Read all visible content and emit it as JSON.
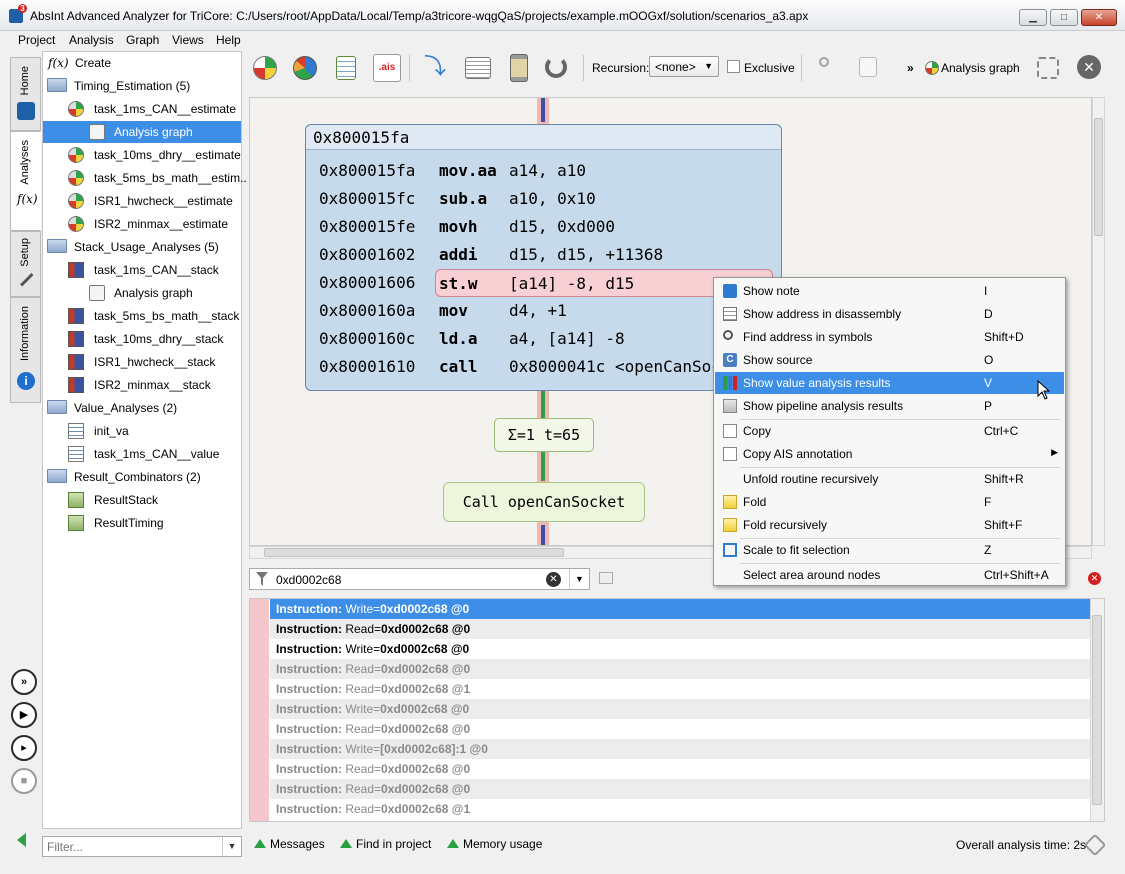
{
  "window": {
    "title": "AbsInt Advanced Analyzer for TriCore: C:/Users/root/AppData/Local/Temp/a3tricore-wqgQaS/projects/example.mOOGxf/solution/scenarios_a3.apx",
    "minimize": "▁",
    "maximize": "□",
    "close": "✕"
  },
  "menu": [
    "Project",
    "Analysis",
    "Graph",
    "Views",
    "Help"
  ],
  "vtabs": [
    "Home",
    "Analyses",
    "Setup",
    "Information"
  ],
  "tree": {
    "create_label": "Create",
    "fx_label": "f(x)",
    "items": [
      {
        "label": "Timing_Estimation (5)",
        "icon": "folder-icon",
        "indent": 0
      },
      {
        "label": "task_1ms_CAN__estimate",
        "icon": "gauge-icon",
        "indent": 1
      },
      {
        "label": "Analysis graph",
        "icon": "graph-icon",
        "indent": 2,
        "selected": true
      },
      {
        "label": "task_10ms_dhry__estimate",
        "icon": "gauge-icon",
        "indent": 1
      },
      {
        "label": "task_5ms_bs_math__estim..",
        "icon": "gauge-icon",
        "indent": 1
      },
      {
        "label": "ISR1_hwcheck__estimate",
        "icon": "gauge-icon",
        "indent": 1
      },
      {
        "label": "ISR2_minmax__estimate",
        "icon": "gauge-icon",
        "indent": 1
      },
      {
        "label": "Stack_Usage_Analyses (5)",
        "icon": "folder-icon",
        "indent": 0
      },
      {
        "label": "task_1ms_CAN__stack",
        "icon": "stack-icon",
        "indent": 1
      },
      {
        "label": "Analysis graph",
        "icon": "graph-icon",
        "indent": 2
      },
      {
        "label": "task_5ms_bs_math__stack",
        "icon": "stack-icon",
        "indent": 1
      },
      {
        "label": "task_10ms_dhry__stack",
        "icon": "stack-icon",
        "indent": 1
      },
      {
        "label": "ISR1_hwcheck__stack",
        "icon": "stack-icon",
        "indent": 1
      },
      {
        "label": "ISR2_minmax__stack",
        "icon": "stack-icon",
        "indent": 1
      },
      {
        "label": "Value_Analyses (2)",
        "icon": "folder-icon",
        "indent": 0
      },
      {
        "label": "init_va",
        "icon": "binary-icon",
        "indent": 1
      },
      {
        "label": "task_1ms_CAN__value",
        "icon": "binary-icon",
        "indent": 1
      },
      {
        "label": "Result_Combinators (2)",
        "icon": "folder-icon",
        "indent": 0
      },
      {
        "label": "ResultStack",
        "icon": "combinator-icon",
        "indent": 1
      },
      {
        "label": "ResultTiming",
        "icon": "combinator-icon",
        "indent": 1
      }
    ]
  },
  "filter": {
    "placeholder": "Filter..."
  },
  "toolbar": {
    "ais_label": ".ais",
    "recursion_label": "Recursion:",
    "recursion_value": "<none>",
    "exclusive_label": "Exclusive",
    "more": "»",
    "analysis_graph_label": "Analysis graph"
  },
  "graph": {
    "block_header": "0x800015fa",
    "instructions": [
      {
        "addr": "0x800015fa",
        "mnemonic": "mov.aa",
        "operands": "a14, a10"
      },
      {
        "addr": "0x800015fc",
        "mnemonic": "sub.a",
        "operands": "a10, 0x10"
      },
      {
        "addr": "0x800015fe",
        "mnemonic": "movh",
        "operands": "d15, 0xd000"
      },
      {
        "addr": "0x80001602",
        "mnemonic": "addi",
        "operands": "d15, d15, +11368"
      },
      {
        "addr": "0x80001606",
        "mnemonic": "st.w",
        "operands": "[a14] -8, d15",
        "highlighted": true
      },
      {
        "addr": "0x8000160a",
        "mnemonic": "mov",
        "operands": "d4, +1"
      },
      {
        "addr": "0x8000160c",
        "mnemonic": "ld.a",
        "operands": "a4, [a14] -8"
      },
      {
        "addr": "0x80001610",
        "mnemonic": "call",
        "operands": "0x8000041c <openCanSoc"
      }
    ],
    "edge_label": "Σ=1 t=65",
    "call_node": "Call openCanSocket"
  },
  "search": {
    "value": "0xd0002c68"
  },
  "results": [
    {
      "prefix": "Instruction:",
      "kind": " Write=",
      "value": "0xd0002c68 @0",
      "state": "selected"
    },
    {
      "prefix": "Instruction:",
      "kind": " Read=",
      "value": "0xd0002c68 @0",
      "state": "bold"
    },
    {
      "prefix": "Instruction:",
      "kind": " Write=",
      "value": "0xd0002c68 @0",
      "state": "bold"
    },
    {
      "prefix": "Instruction:",
      "kind": " Read=",
      "value": "0xd0002c68 @0",
      "state": "dim"
    },
    {
      "prefix": "Instruction:",
      "kind": " Read=",
      "value": "0xd0002c68 @1",
      "state": "dim"
    },
    {
      "prefix": "Instruction:",
      "kind": " Write=",
      "value": "0xd0002c68 @0",
      "state": "dim"
    },
    {
      "prefix": "Instruction:",
      "kind": " Read=",
      "value": "0xd0002c68 @0",
      "state": "dim"
    },
    {
      "prefix": "Instruction:",
      "kind": " Write=",
      "value": "[0xd0002c68]:1 @0",
      "state": "dim"
    },
    {
      "prefix": "Instruction:",
      "kind": " Read=",
      "value": "0xd0002c68 @0",
      "state": "dim"
    },
    {
      "prefix": "Instruction:",
      "kind": " Read=",
      "value": "0xd0002c68 @0",
      "state": "dim"
    },
    {
      "prefix": "Instruction:",
      "kind": " Read=",
      "value": "0xd0002c68 @1",
      "state": "dim"
    }
  ],
  "status": {
    "messages": "Messages",
    "find_in_project": "Find in project",
    "memory_usage": "Memory usage",
    "analysis_time": "Overall analysis time: 2s"
  },
  "context_menu": [
    {
      "label": "Show note",
      "key": "I",
      "icon": "info-icon"
    },
    {
      "label": "Show address in disassembly",
      "key": "D",
      "icon": "disassembly-icon"
    },
    {
      "label": "Find address in symbols",
      "key": "Shift+D",
      "icon": "magnifier-icon"
    },
    {
      "label": "Show source",
      "key": "O",
      "icon": "source-icon",
      "glyph": "C"
    },
    {
      "label": "Show value analysis results",
      "key": "V",
      "icon": "value-analysis-icon",
      "highlighted": true
    },
    {
      "label": "Show pipeline analysis results",
      "key": "P",
      "icon": "pipeline-icon",
      "sep_after": true
    },
    {
      "label": "Copy",
      "key": "Ctrl+C",
      "icon": "copy-icon"
    },
    {
      "label": "Copy AIS annotation",
      "key": "",
      "icon": "copy-icon",
      "submenu": "▶",
      "sep_after": true
    },
    {
      "label": "Unfold routine recursively",
      "key": "Shift+R",
      "icon": "unfold-icon"
    },
    {
      "label": "Fold",
      "key": "F",
      "icon": "fold-icon"
    },
    {
      "label": "Fold recursively",
      "key": "Shift+F",
      "icon": "fold-icon",
      "sep_after": true
    },
    {
      "label": "Scale to fit selection",
      "key": "Z",
      "icon": "scale-icon",
      "sep_after": true
    },
    {
      "label": "Select area around nodes",
      "key": "Ctrl+Shift+A",
      "icon": "select-area-icon"
    }
  ],
  "colors": {
    "selection": "#3d8ee6",
    "block_fill": "#c7daec",
    "highlight_insn": "#f8cfd3",
    "edge_green": "#2aa043",
    "edge_red": "#f1b6b6"
  }
}
